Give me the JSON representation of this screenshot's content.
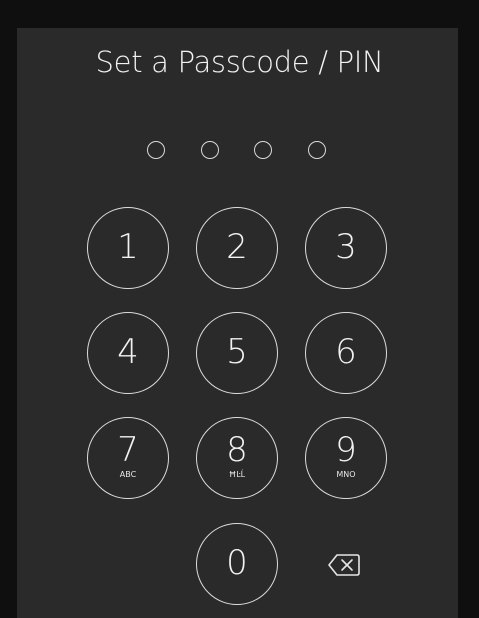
{
  "title": "Set a Passcode / PIN",
  "passcode": {
    "length": 4,
    "filled": 0
  },
  "keypad": {
    "keys": [
      {
        "digit": "1",
        "letters": ""
      },
      {
        "digit": "2",
        "letters": ""
      },
      {
        "digit": "3",
        "letters": ""
      },
      {
        "digit": "4",
        "letters": ""
      },
      {
        "digit": "5",
        "letters": ""
      },
      {
        "digit": "6",
        "letters": ""
      },
      {
        "digit": "7",
        "letters": "ABC"
      },
      {
        "digit": "8",
        "letters": "ĦĿĹ"
      },
      {
        "digit": "9",
        "letters": "MNO"
      },
      {
        "digit": "0",
        "letters": ""
      }
    ],
    "backspace_icon": "backspace-icon"
  },
  "colors": {
    "background": "#0f0f0f",
    "panel": "#2a2a2a",
    "foreground": "#f2f2f2",
    "outline": "#dcdcdc"
  }
}
